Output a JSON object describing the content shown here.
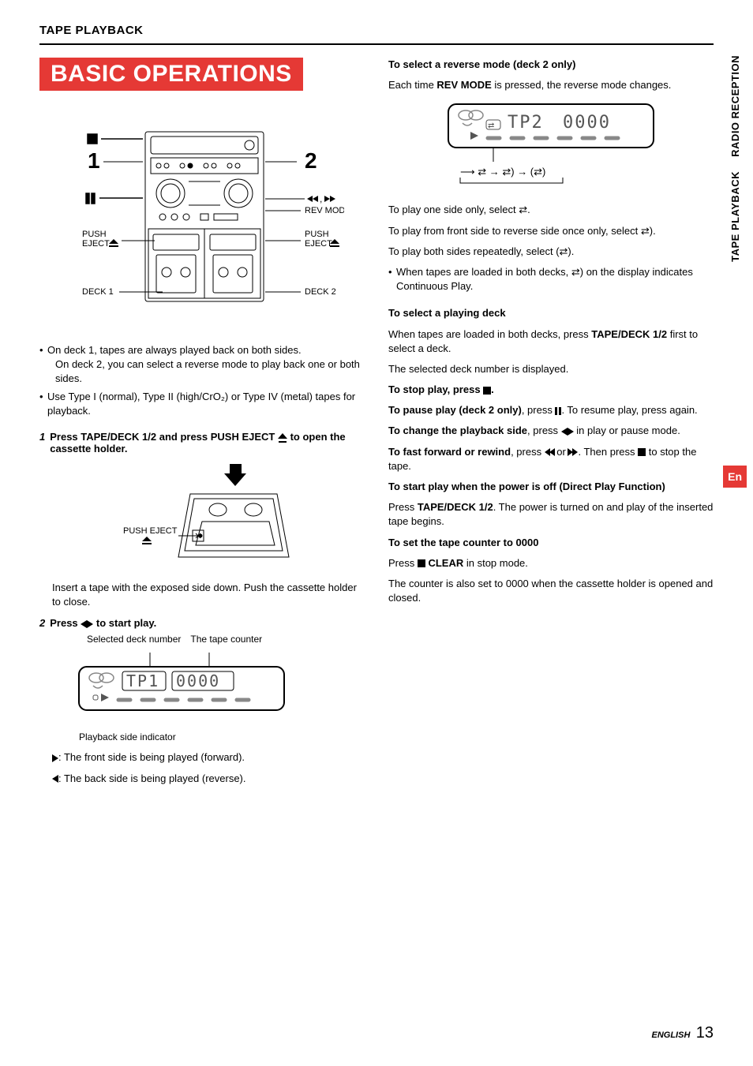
{
  "header": {
    "tape_playback": "TAPE PLAYBACK"
  },
  "section_banner": "BASIC OPERATIONS",
  "side_tabs": {
    "radio": "RADIO RECEPTION",
    "tape": "TAPE PLAYBACK",
    "lang": "En"
  },
  "left": {
    "diagram_labels": {
      "one": "1",
      "two": "2",
      "rev_mode": "REV MODE",
      "push_eject_left": "PUSH\nEJECT",
      "push_eject_right": "PUSH\nEJECT",
      "deck1": "DECK 1",
      "deck2": "DECK 2"
    },
    "bullets": {
      "b1a": "On deck 1, tapes are always played back on both sides.",
      "b1b": "On deck 2, you can select a reverse mode to play back one or both sides.",
      "b2": "Use Type I (normal), Type II (high/CrO₂) or Type IV (metal) tapes for playback."
    },
    "step1_num": "1",
    "step1_text_a": "Press TAPE/DECK 1/2 and press PUSH EJECT ",
    "step1_text_b": " to open the cassette holder.",
    "push_eject_small": "PUSH EJECT",
    "insert_text": "Insert a tape with the exposed side down. Push the cassette holder to close.",
    "step2_num": "2",
    "step2_text_a": "Press ",
    "step2_text_b": " to start play.",
    "caption_selected": "Selected deck number",
    "caption_counter": "The tape counter",
    "lcd_tp1": "TP1",
    "lcd_0000_a": "0000",
    "indicator_caption": "Playback side indicator",
    "fwd_line": ": The front side is being played (forward).",
    "rev_line": ": The back side is being played (reverse)."
  },
  "right": {
    "h_reverse": "To select a reverse mode (deck 2 only)",
    "reverse_line": "Each time REV MODE is pressed, the reverse mode changes.",
    "lcd_tp2": "TP2",
    "lcd_0000_b": "0000",
    "play_one": "To play one side only, select ⇄.",
    "play_front_rev": "To play from front side to reverse side once only, select ⇄).",
    "play_both": "To play both sides repeatedly, select (⇄).",
    "cont_play": "When tapes are loaded in both decks, ⇄) on the display indicates Continuous Play.",
    "h_deck": "To select a playing deck",
    "deck_line1": "When tapes are loaded in both decks, press TAPE/DECK 1/2 first to select a deck.",
    "deck_line2": "The selected deck number is displayed.",
    "h_stop": "To stop play, press ",
    "stop_dot": ".",
    "pause_a": "To pause play (deck 2 only)",
    "pause_b": ", press ",
    "pause_c": ". To resume play, press again.",
    "change_a": "To change the playback side",
    "change_b": ", press ",
    "change_c": " in play or pause mode.",
    "ff_a": "To fast forward or rewind",
    "ff_b": ", press ",
    "ff_c": " or ",
    "ff_d": ". Then press ",
    "ff_e": " to stop the tape.",
    "h_direct": "To start play when the power is off (Direct Play Function)",
    "direct_line": "Press TAPE/DECK 1/2. The power is turned on and play of the inserted tape begins.",
    "h_counter": "To set the tape counter to 0000",
    "counter_a": "Press ",
    "counter_clear": " CLEAR",
    "counter_b": " in stop mode.",
    "counter_line2": "The counter is also set to 0000 when the cassette holder is opened and closed."
  },
  "footer": {
    "lang": "ENGLISH",
    "num": "13"
  }
}
